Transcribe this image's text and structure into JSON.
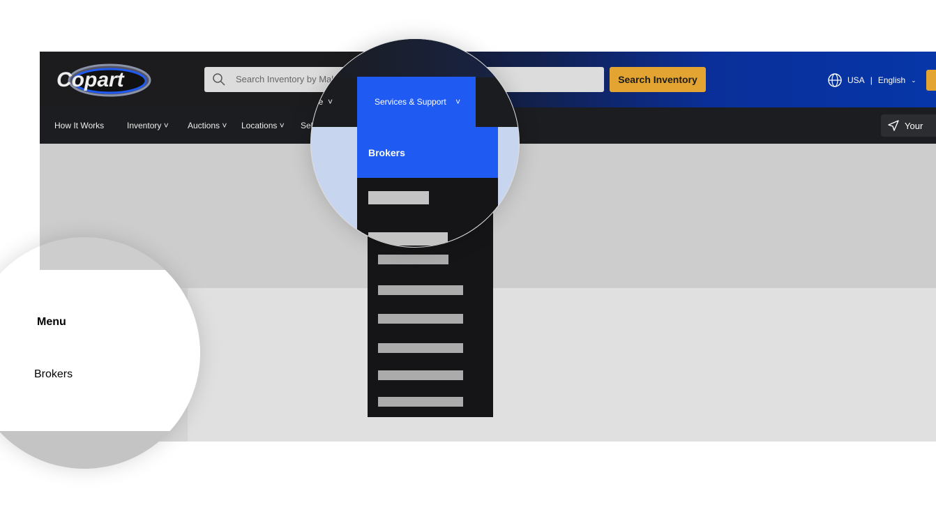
{
  "header": {
    "logo_text": "Copart",
    "search_placeholder": "Search Inventory by Make",
    "search_button": "Search Inventory",
    "region": "USA",
    "separator": "|",
    "language": "English"
  },
  "nav": {
    "items": [
      "How It Works",
      "Inventory",
      "Auctions",
      "Locations",
      "Sel"
    ],
    "partial_item": "le",
    "location_button": "Your"
  },
  "magnifier": {
    "menu_item": "Services & Support",
    "submenu_selected": "Brokers"
  },
  "mobile_magnifier": {
    "title": "Menu",
    "item": "Brokers"
  },
  "colors": {
    "accent_yellow": "#e3a431",
    "highlight_blue": "#1f5af3",
    "header_dark": "#1c1c1e"
  }
}
